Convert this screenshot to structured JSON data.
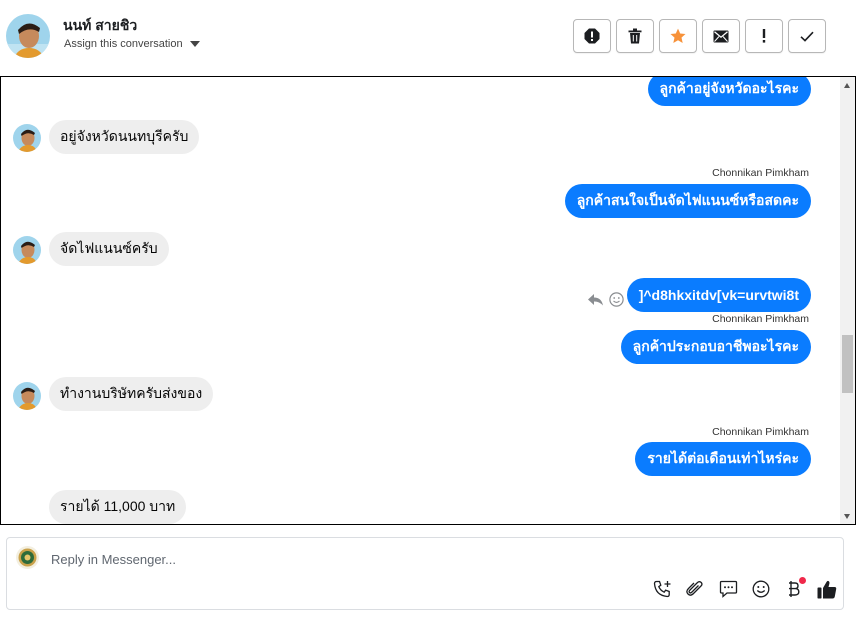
{
  "header": {
    "contact_name": "นนท์ สายชิว",
    "assign_label": "Assign this conversation",
    "actions": [
      "spam-icon",
      "trash-icon",
      "star-icon",
      "mail-icon",
      "exclamation-icon",
      "check-icon"
    ],
    "star_color": "#f7923a"
  },
  "thread": {
    "messages": [
      {
        "dir": "out",
        "text": "ลูกค้าอยู่จังหวัดอะไรคะ"
      },
      {
        "dir": "in",
        "text": "อยู่จังหวัดนนทบุรีครับ"
      },
      {
        "dir": "out",
        "sender": "Chonnikan Pimkham",
        "text": "ลูกค้าสนใจเป็นจัดไฟแนนซ์หรือสดคะ"
      },
      {
        "dir": "in",
        "text": "จัดไฟแนนซ์ครับ"
      },
      {
        "dir": "out",
        "text": "]^d8hkxitdv[vk=urvtwi8t"
      },
      {
        "dir": "out",
        "sender": "Chonnikan Pimkham",
        "text": "ลูกค้าประกอบอาชีพอะไรคะ"
      },
      {
        "dir": "in",
        "text": "ทำงานบริษัทครับส่งของ"
      },
      {
        "dir": "out",
        "sender": "Chonnikan Pimkham",
        "text": "รายได้ต่อเดือนเท่าไหร่คะ"
      },
      {
        "dir": "in",
        "text": "รายได้ 11,000 บาท"
      }
    ]
  },
  "composer": {
    "placeholder": "Reply in Messenger...",
    "tools": [
      "call-add-icon",
      "attachment-icon",
      "saved-replies-icon",
      "emoji-icon",
      "payment-icon",
      "like-icon"
    ]
  },
  "colors": {
    "outgoing_bubble": "#0a7cff",
    "incoming_bubble": "#eeeeee",
    "notification_dot": "#f0284a"
  }
}
